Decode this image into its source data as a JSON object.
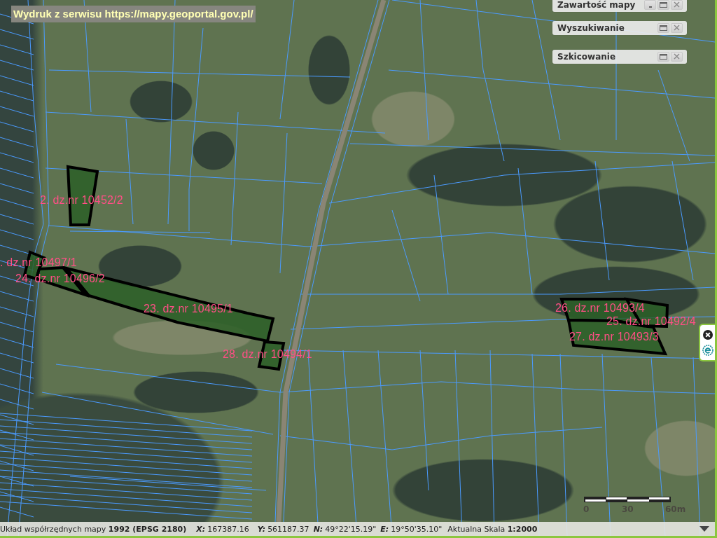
{
  "print_banner": {
    "text": "Wydruk z serwisu https://mapy.geoportal.gov.pl/"
  },
  "panels": [
    {
      "title": "Zawartość mapy",
      "minimize_button": true
    },
    {
      "title": "Wyszukiwanie",
      "minimize_button": false
    },
    {
      "title": "Szkicowanie",
      "minimize_button": false
    }
  ],
  "parcels": [
    {
      "label": "2. dz.nr 10452/2"
    },
    {
      "label": ". dz.nr 10497/1"
    },
    {
      "label": "24. dz.nr 10496/2"
    },
    {
      "label": "23. dz.nr 10495/1"
    },
    {
      "label": "28. dz.nr 10494/1"
    },
    {
      "label": "26. dz.nr 10493/4"
    },
    {
      "label": "25. dz.nr 10492/4"
    },
    {
      "label": "27. dz.nr 10493/3"
    }
  ],
  "scale_bar": {
    "labels": [
      "0",
      "30",
      "60m"
    ]
  },
  "status_bar": {
    "crs": "Układ współrzędnych mapy **1992 (EPSG 2180)**",
    "coordinates": [
      {
        "label": "X:",
        "value": "167387.16"
      },
      {
        "label": "Y:",
        "value": "561187.37"
      },
      {
        "label": "N:",
        "value": "49°22'15.19\""
      },
      {
        "label": "E:",
        "value": "19°50'35.10\""
      }
    ],
    "scale": "Aktualna Skala **1:2000**"
  }
}
